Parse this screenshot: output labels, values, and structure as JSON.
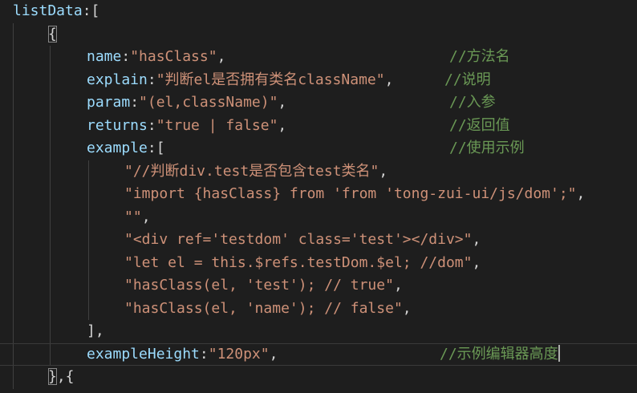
{
  "editor": {
    "theme": {
      "background": "#1e1e1e",
      "property_color": "#9cdcfe",
      "string_color": "#ce9178",
      "comment_color": "#6a9955",
      "punctuation_color": "#d4d4d4"
    },
    "lines": [
      {
        "tokens": [
          {
            "t": "k",
            "v": "listData"
          },
          {
            "t": "p",
            "v": ":["
          }
        ]
      },
      {
        "tokens": [
          {
            "t": "p",
            "v": "{",
            "match": true
          }
        ]
      },
      {
        "tokens": [
          {
            "t": "k",
            "v": "name"
          },
          {
            "t": "p",
            "v": ":"
          },
          {
            "t": "s",
            "v": "\"hasClass\""
          },
          {
            "t": "p",
            "v": ","
          }
        ],
        "comment": "//方法名"
      },
      {
        "tokens": [
          {
            "t": "k",
            "v": "explain"
          },
          {
            "t": "p",
            "v": ":"
          },
          {
            "t": "s",
            "v": "\"判断el是否拥有类名className\""
          },
          {
            "t": "p",
            "v": ","
          }
        ],
        "comment": "//说明"
      },
      {
        "tokens": [
          {
            "t": "k",
            "v": "param"
          },
          {
            "t": "p",
            "v": ":"
          },
          {
            "t": "s",
            "v": "\"(el,className)\""
          },
          {
            "t": "p",
            "v": ","
          }
        ],
        "comment": "//入参"
      },
      {
        "tokens": [
          {
            "t": "k",
            "v": "returns"
          },
          {
            "t": "p",
            "v": ":"
          },
          {
            "t": "s",
            "v": "\"true | false\""
          },
          {
            "t": "p",
            "v": ","
          }
        ],
        "comment": "//返回值"
      },
      {
        "tokens": [
          {
            "t": "k",
            "v": "example"
          },
          {
            "t": "p",
            "v": ":["
          }
        ],
        "comment": "//使用示例"
      },
      {
        "tokens": [
          {
            "t": "s",
            "v": "\"//判断div.test是否包含test类名\""
          },
          {
            "t": "p",
            "v": ","
          }
        ]
      },
      {
        "tokens": [
          {
            "t": "s",
            "v": "\"import {hasClass} from 'from 'tong-zui-ui/js/dom';\""
          },
          {
            "t": "p",
            "v": ","
          }
        ]
      },
      {
        "tokens": [
          {
            "t": "s",
            "v": "\"\""
          },
          {
            "t": "p",
            "v": ","
          }
        ]
      },
      {
        "tokens": [
          {
            "t": "s",
            "v": "\"<div ref='testdom' class='test'></div>\""
          },
          {
            "t": "p",
            "v": ","
          }
        ]
      },
      {
        "tokens": [
          {
            "t": "s",
            "v": "\"let el = this.$refs.testDom.$el; //dom\""
          },
          {
            "t": "p",
            "v": ","
          }
        ]
      },
      {
        "tokens": [
          {
            "t": "s",
            "v": "\"hasClass(el, 'test'); // true\""
          },
          {
            "t": "p",
            "v": ","
          }
        ]
      },
      {
        "tokens": [
          {
            "t": "s",
            "v": "\"hasClass(el, 'name'); // false\""
          },
          {
            "t": "p",
            "v": ","
          }
        ]
      },
      {
        "tokens": [
          {
            "t": "p",
            "v": "],"
          }
        ]
      },
      {
        "tokens": [
          {
            "t": "k",
            "v": "exampleHeight"
          },
          {
            "t": "p",
            "v": ":"
          },
          {
            "t": "s",
            "v": "\"120px\""
          },
          {
            "t": "p",
            "v": ","
          }
        ],
        "comment": "//示例编辑器高度",
        "current": true,
        "caret": true
      },
      {
        "tokens": [
          {
            "t": "p",
            "v": "}",
            "match": true
          },
          {
            "t": "p",
            "v": ",{"
          }
        ]
      }
    ]
  }
}
